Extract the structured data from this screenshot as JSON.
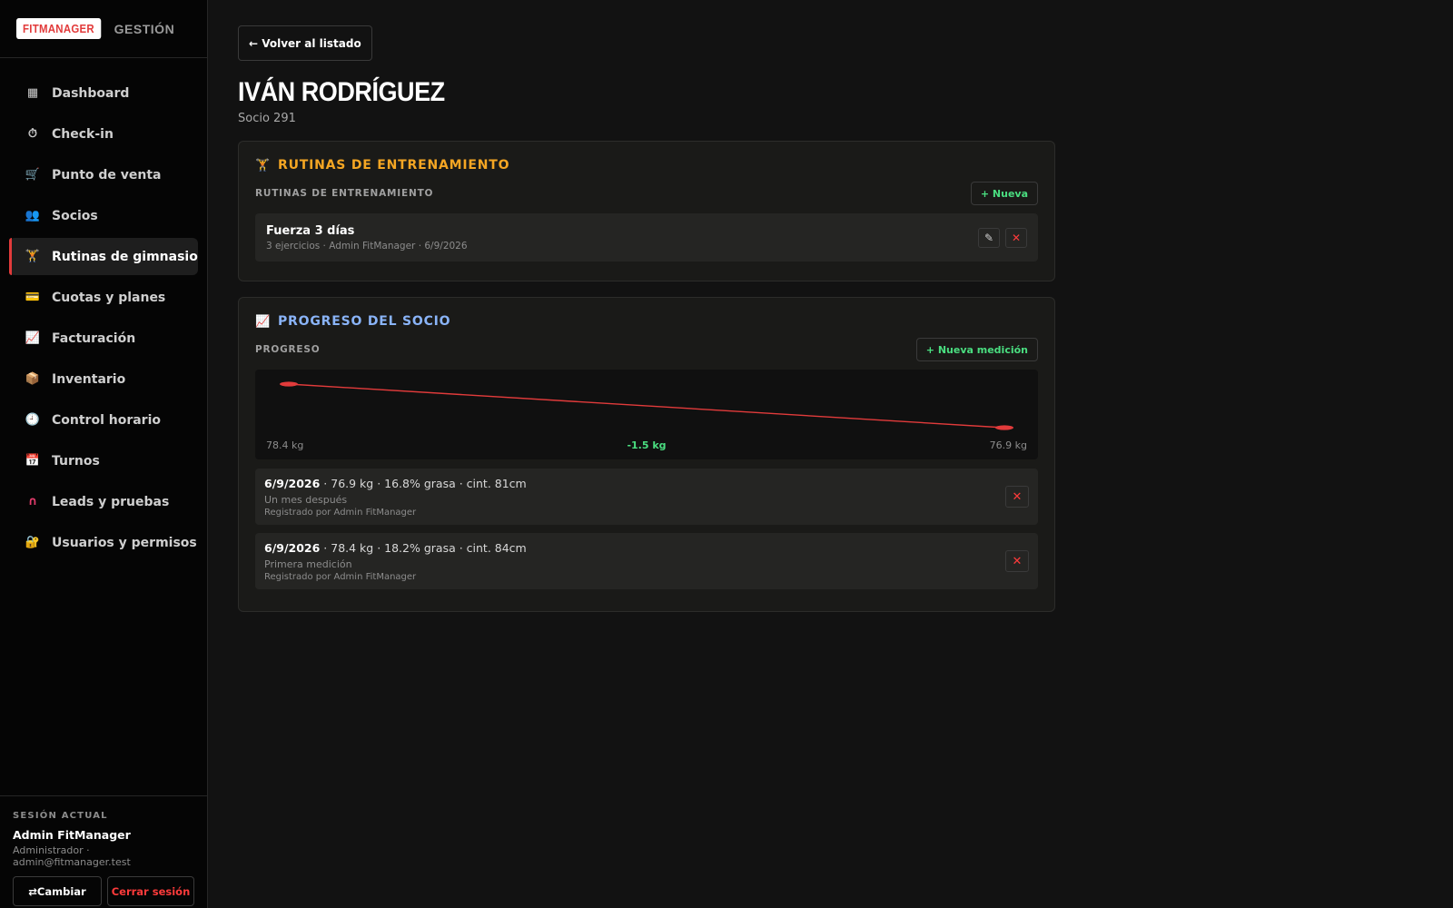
{
  "brand": {
    "logo": "FITMANAGER",
    "section": "GESTIÓN"
  },
  "nav": [
    {
      "icon": "▦",
      "icon_name": "dashboard-icon",
      "label": "Dashboard",
      "active": false
    },
    {
      "icon": "⏱",
      "icon_name": "stopwatch-icon",
      "label": "Check-in",
      "active": false
    },
    {
      "icon": "🛒",
      "icon_name": "cart-icon",
      "label": "Punto de venta",
      "active": false
    },
    {
      "icon": "👥",
      "icon_name": "users-icon",
      "label": "Socios",
      "active": false
    },
    {
      "icon": "🏋",
      "icon_name": "dumbbell-icon",
      "label": "Rutinas de gimnasio",
      "active": true
    },
    {
      "icon": "💳",
      "icon_name": "card-icon",
      "label": "Cuotas y planes",
      "active": false
    },
    {
      "icon": "📈",
      "icon_name": "chart-icon",
      "label": "Facturación",
      "active": false
    },
    {
      "icon": "📦",
      "icon_name": "box-icon",
      "label": "Inventario",
      "active": false
    },
    {
      "icon": "🕘",
      "icon_name": "clock-icon",
      "label": "Control horario",
      "active": false
    },
    {
      "icon": "📅",
      "icon_name": "calendar-icon",
      "label": "Turnos",
      "active": false
    },
    {
      "icon": "∩",
      "icon_name": "magnet-icon",
      "label": "Leads y pruebas",
      "active": false
    },
    {
      "icon": "🔐",
      "icon_name": "lock-icon",
      "label": "Usuarios y permisos",
      "active": false
    }
  ],
  "session": {
    "caption": "SESIÓN ACTUAL",
    "name": "Admin FitManager",
    "role": "Administrador · admin@fitmanager.test",
    "switch_label": "⇄Cambiar",
    "logout_label": "Cerrar sesión"
  },
  "header": {
    "back_label": "← Volver al listado",
    "member_name": "IVÁN RODRÍGUEZ",
    "member_sub": "Socio 291"
  },
  "routines": {
    "title_icon": "🏋",
    "title": "RUTINAS DE ENTRENAMIENTO",
    "section_label": "RUTINAS DE ENTRENAMIENTO",
    "new_label": "+ Nueva",
    "items": [
      {
        "name": "Fuerza 3 días",
        "meta": "3 ejercicios · Admin FitManager · 6/9/2026",
        "edit_icon": "✎",
        "delete_icon": "✕"
      }
    ]
  },
  "progress": {
    "title_icon": "📈",
    "title": "PROGRESO DEL SOCIO",
    "section_label": "PROGRESO",
    "new_label": "+ Nueva medición",
    "chart": {
      "first_label": "78.4 kg",
      "delta_label": "-1.5 kg",
      "last_label": "76.9 kg",
      "line_color": "#e23b3b",
      "delta_color": "#4ade80"
    },
    "measurements": [
      {
        "date": "6/9/2026",
        "details": " · 76.9 kg · 16.8% grasa · cint. 81cm",
        "note": "Un mes después",
        "by": "Registrado por Admin FitManager",
        "delete_icon": "✕"
      },
      {
        "date": "6/9/2026",
        "details": " · 78.4 kg · 18.2% grasa · cint. 84cm",
        "note": "Primera medición",
        "by": "Registrado por Admin FitManager",
        "delete_icon": "✕"
      }
    ]
  },
  "chart_data": {
    "type": "line",
    "x": [
      "6/9/2026",
      "6/9/2026"
    ],
    "series": [
      {
        "values": [
          78.4,
          76.9
        ]
      }
    ]
  }
}
